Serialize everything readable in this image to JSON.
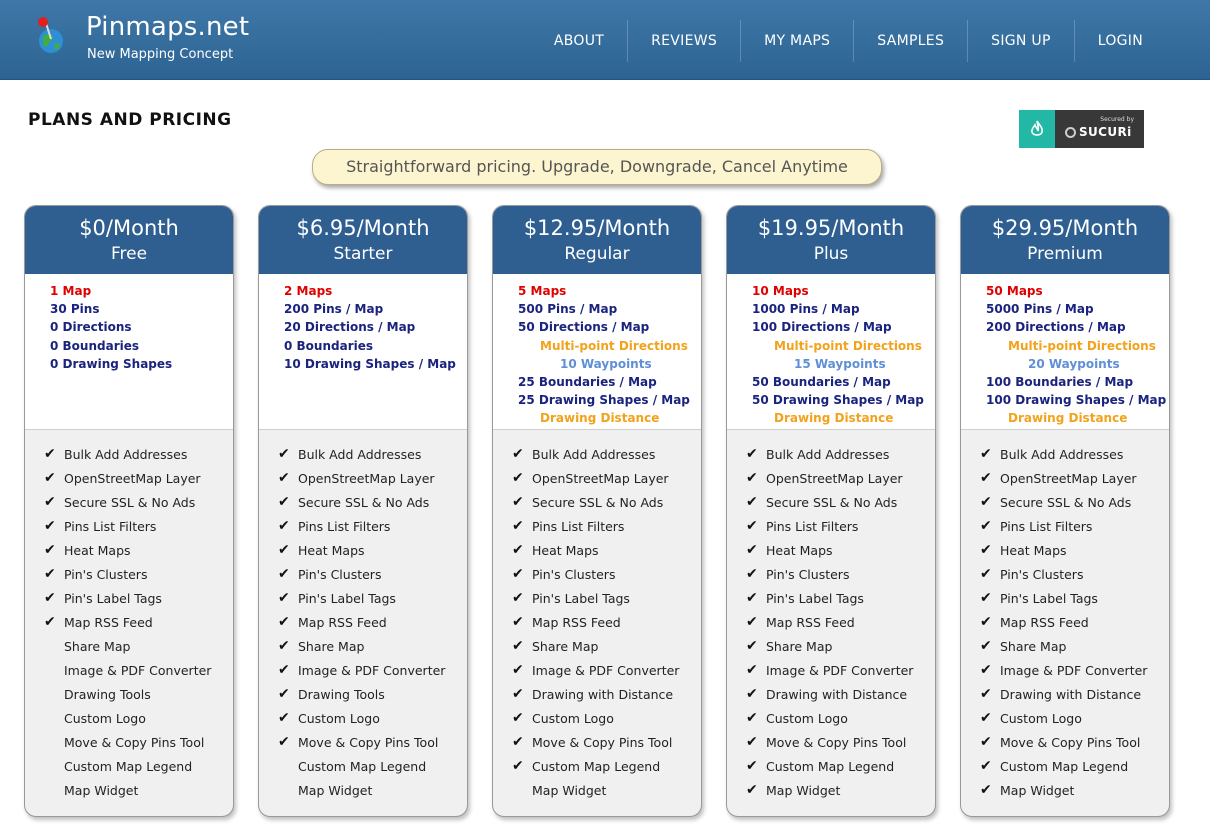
{
  "header": {
    "site_name": "Pinmaps.net",
    "tagline": "New Mapping Concept",
    "nav": [
      "ABOUT",
      "REVIEWS",
      "MY MAPS",
      "SAMPLES",
      "SIGN UP",
      "LOGIN"
    ]
  },
  "page": {
    "title": "PLANS AND PRICING",
    "banner": "Straightforward pricing. Upgrade, Downgrade, Cancel Anytime",
    "sucuri": {
      "secured": "Secured by",
      "name": "SUCURi"
    }
  },
  "colors": {
    "header": "#2c6393",
    "plan_head": "#2e5f90",
    "limit_red": "#e00000",
    "limit_navy": "#1a237e",
    "limit_orange": "#f2a21b",
    "limit_blue": "#5f8fd6"
  },
  "features": [
    "Bulk Add Addresses",
    "OpenStreetMap Layer",
    "Secure SSL & No Ads",
    "Pins List Filters",
    "Heat Maps",
    "Pin's Clusters",
    "Pin's Label Tags",
    "Map RSS Feed",
    "Share Map",
    "Image & PDF Converter",
    "Drawing Tools",
    "Custom Logo",
    "Move & Copy Pins Tool",
    "Custom Map Legend",
    "Map Widget"
  ],
  "plans": [
    {
      "price": "$0/Month",
      "name": "Free",
      "limits": [
        {
          "text": "1 Map",
          "style": "red"
        },
        {
          "text": "30 Pins",
          "style": "navy"
        },
        {
          "text": "0 Directions",
          "style": "navy"
        },
        {
          "text": "0 Boundaries",
          "style": "navy"
        },
        {
          "text": "0 Drawing Shapes",
          "style": "navy"
        }
      ],
      "features": [
        {
          "label": "Bulk Add Addresses",
          "checked": true
        },
        {
          "label": "OpenStreetMap Layer",
          "checked": true
        },
        {
          "label": "Secure SSL & No Ads",
          "checked": true
        },
        {
          "label": "Pins List Filters",
          "checked": true
        },
        {
          "label": "Heat Maps",
          "checked": true
        },
        {
          "label": "Pin's Clusters",
          "checked": true
        },
        {
          "label": "Pin's Label Tags",
          "checked": true
        },
        {
          "label": "Map RSS Feed",
          "checked": true
        },
        {
          "label": "Share Map",
          "checked": false
        },
        {
          "label": "Image & PDF Converter",
          "checked": false
        },
        {
          "label": "Drawing Tools",
          "checked": false
        },
        {
          "label": "Custom Logo",
          "checked": false
        },
        {
          "label": "Move & Copy Pins Tool",
          "checked": false
        },
        {
          "label": "Custom Map Legend",
          "checked": false
        },
        {
          "label": "Map Widget",
          "checked": false
        }
      ]
    },
    {
      "price": "$6.95/Month",
      "name": "Starter",
      "limits": [
        {
          "text": "2 Maps",
          "style": "red"
        },
        {
          "text": "200 Pins / Map",
          "style": "navy"
        },
        {
          "text": "20 Directions / Map",
          "style": "navy"
        },
        {
          "text": "0 Boundaries",
          "style": "navy"
        },
        {
          "text": "10 Drawing Shapes / Map",
          "style": "navy"
        }
      ],
      "features": [
        {
          "label": "Bulk Add Addresses",
          "checked": true
        },
        {
          "label": "OpenStreetMap Layer",
          "checked": true
        },
        {
          "label": "Secure SSL & No Ads",
          "checked": true
        },
        {
          "label": "Pins List Filters",
          "checked": true
        },
        {
          "label": "Heat Maps",
          "checked": true
        },
        {
          "label": "Pin's Clusters",
          "checked": true
        },
        {
          "label": "Pin's Label Tags",
          "checked": true
        },
        {
          "label": "Map RSS Feed",
          "checked": true
        },
        {
          "label": "Share Map",
          "checked": true
        },
        {
          "label": "Image & PDF Converter",
          "checked": true
        },
        {
          "label": "Drawing Tools",
          "checked": true
        },
        {
          "label": "Custom Logo",
          "checked": true
        },
        {
          "label": "Move & Copy Pins Tool",
          "checked": true
        },
        {
          "label": "Custom Map Legend",
          "checked": false
        },
        {
          "label": "Map Widget",
          "checked": false
        }
      ]
    },
    {
      "price": "$12.95/Month",
      "name": "Regular",
      "limits": [
        {
          "text": "5 Maps",
          "style": "red"
        },
        {
          "text": "500 Pins / Map",
          "style": "navy"
        },
        {
          "text": "50 Directions / Map",
          "style": "navy"
        },
        {
          "text": "Multi-point Directions",
          "style": "orange"
        },
        {
          "text": "10 Waypoints",
          "style": "blue"
        },
        {
          "text": "25 Boundaries / Map",
          "style": "navy"
        },
        {
          "text": "25 Drawing Shapes / Map",
          "style": "navy"
        },
        {
          "text": "Drawing Distance",
          "style": "orange"
        }
      ],
      "features": [
        {
          "label": "Bulk Add Addresses",
          "checked": true
        },
        {
          "label": "OpenStreetMap Layer",
          "checked": true
        },
        {
          "label": "Secure SSL & No Ads",
          "checked": true
        },
        {
          "label": "Pins List Filters",
          "checked": true
        },
        {
          "label": "Heat Maps",
          "checked": true
        },
        {
          "label": "Pin's Clusters",
          "checked": true
        },
        {
          "label": "Pin's Label Tags",
          "checked": true
        },
        {
          "label": "Map RSS Feed",
          "checked": true
        },
        {
          "label": "Share Map",
          "checked": true
        },
        {
          "label": "Image & PDF Converter",
          "checked": true
        },
        {
          "label": "Drawing with Distance",
          "checked": true
        },
        {
          "label": "Custom Logo",
          "checked": true
        },
        {
          "label": "Move & Copy Pins Tool",
          "checked": true
        },
        {
          "label": "Custom Map Legend",
          "checked": true
        },
        {
          "label": "Map Widget",
          "checked": false
        }
      ]
    },
    {
      "price": "$19.95/Month",
      "name": "Plus",
      "limits": [
        {
          "text": "10 Maps",
          "style": "red"
        },
        {
          "text": "1000 Pins / Map",
          "style": "navy"
        },
        {
          "text": "100 Directions / Map",
          "style": "navy"
        },
        {
          "text": "Multi-point Directions",
          "style": "orange"
        },
        {
          "text": "15 Waypoints",
          "style": "blue"
        },
        {
          "text": "50 Boundaries / Map",
          "style": "navy"
        },
        {
          "text": "50 Drawing Shapes / Map",
          "style": "navy"
        },
        {
          "text": "Drawing Distance",
          "style": "orange"
        }
      ],
      "features": [
        {
          "label": "Bulk Add Addresses",
          "checked": true
        },
        {
          "label": "OpenStreetMap Layer",
          "checked": true
        },
        {
          "label": "Secure SSL & No Ads",
          "checked": true
        },
        {
          "label": "Pins List Filters",
          "checked": true
        },
        {
          "label": "Heat Maps",
          "checked": true
        },
        {
          "label": "Pin's Clusters",
          "checked": true
        },
        {
          "label": "Pin's Label Tags",
          "checked": true
        },
        {
          "label": "Map RSS Feed",
          "checked": true
        },
        {
          "label": "Share Map",
          "checked": true
        },
        {
          "label": "Image & PDF Converter",
          "checked": true
        },
        {
          "label": "Drawing with Distance",
          "checked": true
        },
        {
          "label": "Custom Logo",
          "checked": true
        },
        {
          "label": "Move & Copy Pins Tool",
          "checked": true
        },
        {
          "label": "Custom Map Legend",
          "checked": true
        },
        {
          "label": "Map Widget",
          "checked": true
        }
      ]
    },
    {
      "price": "$29.95/Month",
      "name": "Premium",
      "limits": [
        {
          "text": "50 Maps",
          "style": "red"
        },
        {
          "text": "5000 Pins / Map",
          "style": "navy"
        },
        {
          "text": "200 Directions / Map",
          "style": "navy"
        },
        {
          "text": "Multi-point Directions",
          "style": "orange"
        },
        {
          "text": "20 Waypoints",
          "style": "blue"
        },
        {
          "text": "100 Boundaries / Map",
          "style": "navy"
        },
        {
          "text": "100 Drawing Shapes / Map",
          "style": "navy"
        },
        {
          "text": "Drawing Distance",
          "style": "orange"
        }
      ],
      "features": [
        {
          "label": "Bulk Add Addresses",
          "checked": true
        },
        {
          "label": "OpenStreetMap Layer",
          "checked": true
        },
        {
          "label": "Secure SSL & No Ads",
          "checked": true
        },
        {
          "label": "Pins List Filters",
          "checked": true
        },
        {
          "label": "Heat Maps",
          "checked": true
        },
        {
          "label": "Pin's Clusters",
          "checked": true
        },
        {
          "label": "Pin's Label Tags",
          "checked": true
        },
        {
          "label": "Map RSS Feed",
          "checked": true
        },
        {
          "label": "Share Map",
          "checked": true
        },
        {
          "label": "Image & PDF Converter",
          "checked": true
        },
        {
          "label": "Drawing with Distance",
          "checked": true
        },
        {
          "label": "Custom Logo",
          "checked": true
        },
        {
          "label": "Move & Copy Pins Tool",
          "checked": true
        },
        {
          "label": "Custom Map Legend",
          "checked": true
        },
        {
          "label": "Map Widget",
          "checked": true
        }
      ]
    }
  ]
}
